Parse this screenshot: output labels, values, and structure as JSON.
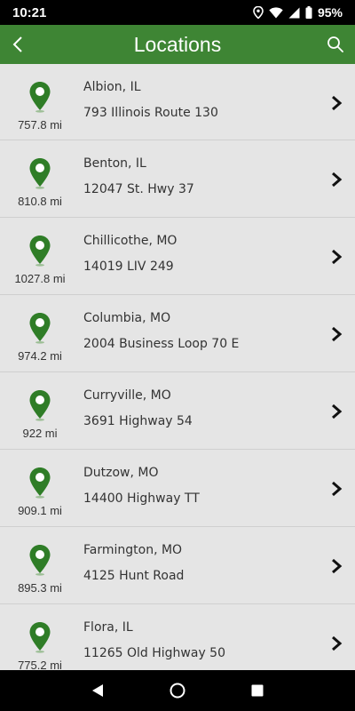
{
  "status_bar": {
    "time": "10:21",
    "battery": "95%"
  },
  "app_bar": {
    "title": "Locations"
  },
  "colors": {
    "brand_green": "#3e8534",
    "pin_green": "#2f7d27"
  },
  "locations": [
    {
      "city": "Albion, IL",
      "address": "793 Illinois Route 130",
      "distance": "757.8 mi"
    },
    {
      "city": "Benton, IL",
      "address": "12047 St. Hwy 37",
      "distance": "810.8 mi"
    },
    {
      "city": "Chillicothe, MO",
      "address": "14019 LIV 249",
      "distance": "1027.8 mi"
    },
    {
      "city": "Columbia, MO",
      "address": "2004 Business Loop 70 E",
      "distance": "974.2 mi"
    },
    {
      "city": "Curryville, MO",
      "address": "3691 Highway 54",
      "distance": "922 mi"
    },
    {
      "city": "Dutzow, MO",
      "address": "14400 Highway TT",
      "distance": "909.1 mi"
    },
    {
      "city": "Farmington, MO",
      "address": "4125 Hunt Road",
      "distance": "895.3 mi"
    },
    {
      "city": "Flora, IL",
      "address": "11265 Old Highway 50",
      "distance": "775.2 mi"
    }
  ],
  "icons": {
    "location": "map-pin-icon",
    "row_action": "chevron-right-icon",
    "back": "chevron-left-icon",
    "search": "search-icon"
  }
}
